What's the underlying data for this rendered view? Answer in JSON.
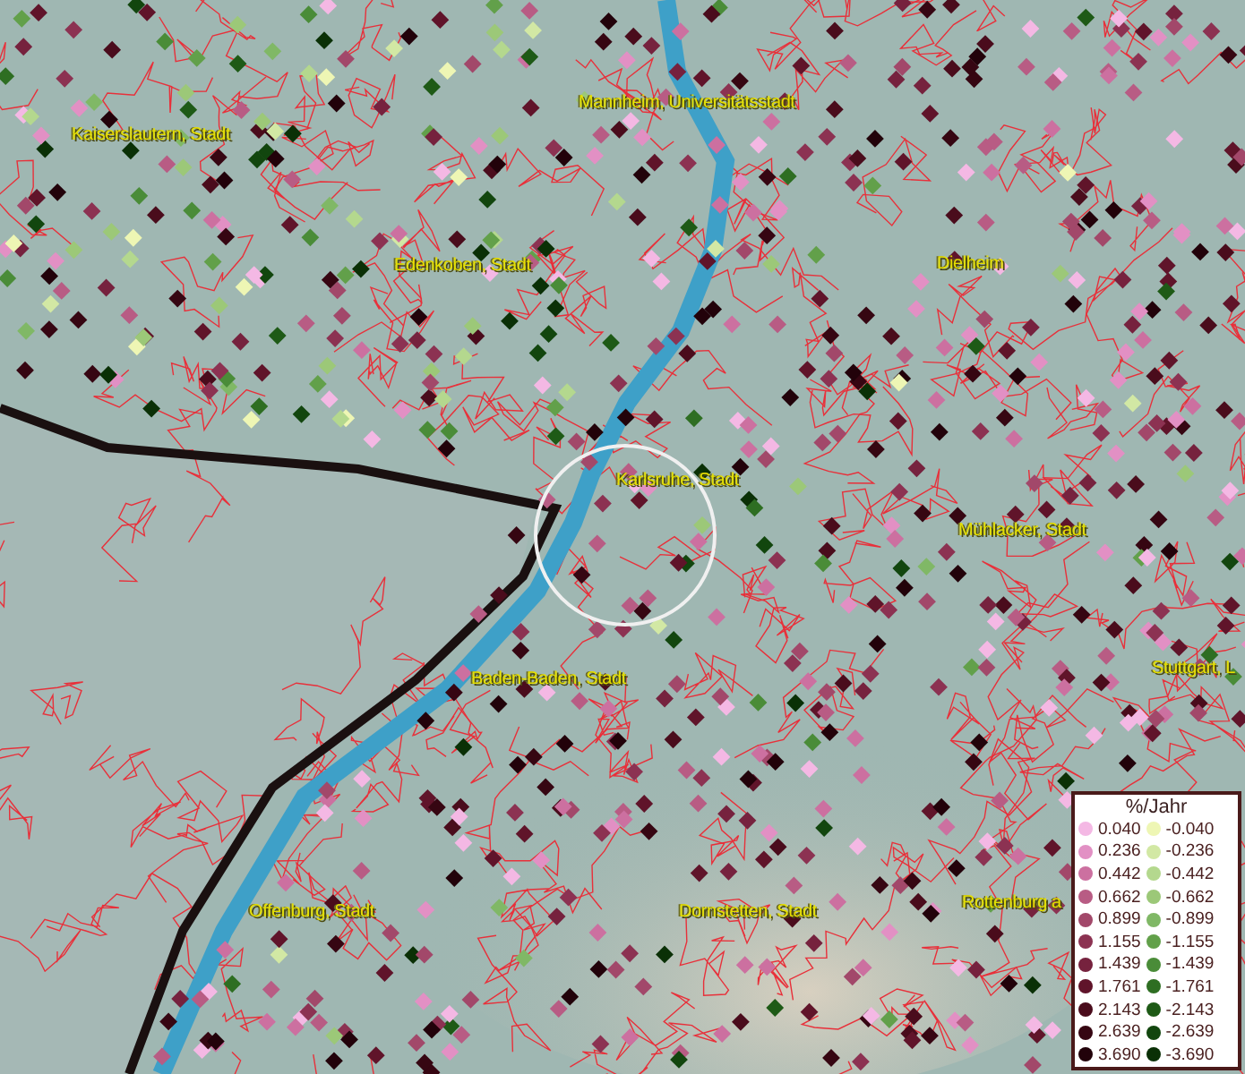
{
  "map": {
    "labels": [
      {
        "text": "Kaiserslautern, Stadt"
      },
      {
        "text": "Mannheim, Universitätsstadt"
      },
      {
        "text": "Edenkoben, Stadt"
      },
      {
        "text": "Dielheim"
      },
      {
        "text": "Karlsruhe, Stadt"
      },
      {
        "text": "Mühlacker, Stadt"
      },
      {
        "text": "Stuttgart, L"
      },
      {
        "text": "Baden-Baden, Stadt"
      },
      {
        "text": "Offenburg, Stadt"
      },
      {
        "text": "Dornstetten, Stadt"
      },
      {
        "text": "Rottenburg a"
      }
    ]
  },
  "legend": {
    "title": "%/Jahr",
    "columns": [
      {
        "items": [
          {
            "value": "0.040",
            "color": "#f4b8e4"
          },
          {
            "value": "0.236",
            "color": "#e290c4"
          },
          {
            "value": "0.442",
            "color": "#cc70a0"
          },
          {
            "value": "0.662",
            "color": "#b85c84"
          },
          {
            "value": "0.899",
            "color": "#a2486a"
          },
          {
            "value": "1.155",
            "color": "#8c3252"
          },
          {
            "value": "1.439",
            "color": "#76223e"
          },
          {
            "value": "1.761",
            "color": "#60142a"
          },
          {
            "value": "2.143",
            "color": "#4a0c1c"
          },
          {
            "value": "2.639",
            "color": "#360612"
          },
          {
            "value": "3.690",
            "color": "#22020a"
          }
        ]
      },
      {
        "items": [
          {
            "value": "-0.040",
            "color": "#eef6b4"
          },
          {
            "value": "-0.236",
            "color": "#d2e8a4"
          },
          {
            "value": "-0.442",
            "color": "#b4d88e"
          },
          {
            "value": "-0.662",
            "color": "#9cc878"
          },
          {
            "value": "-0.899",
            "color": "#80b866"
          },
          {
            "value": "-1.155",
            "color": "#62a04a"
          },
          {
            "value": "-1.439",
            "color": "#4a8c38"
          },
          {
            "value": "-1.761",
            "color": "#2e6e22"
          },
          {
            "value": "-2.143",
            "color": "#1e5a16"
          },
          {
            "value": "-2.639",
            "color": "#12460e"
          },
          {
            "value": "-3.690",
            "color": "#0a3006"
          }
        ]
      }
    ]
  }
}
